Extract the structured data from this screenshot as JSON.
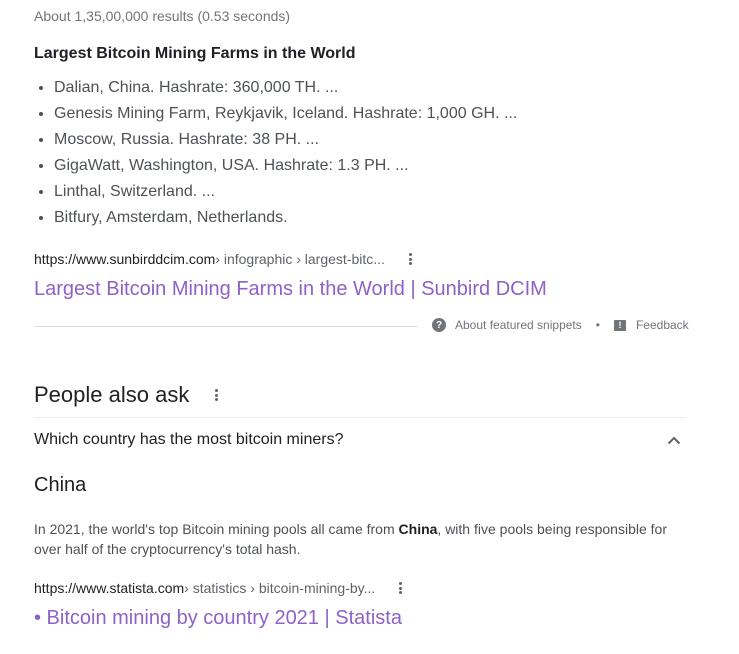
{
  "stats": "About 1,35,00,000 results (0.53 seconds)",
  "featured_snippet": {
    "title": "Largest Bitcoin Mining Farms in the World",
    "items": [
      "Dalian, China. Hashrate: 360,000 TH. ...",
      "Genesis Mining Farm, Reykjavik, Iceland. Hashrate: 1,000 GH. ...",
      "Moscow, Russia. Hashrate: 38 PH. ...",
      "GigaWatt, Washington, USA. Hashrate: 1.3 PH. ...",
      "Linthal, Switzerland. ...",
      "Bitfury, Amsterdam, Netherlands."
    ],
    "cite_domain": "https://www.sunbirddcim.com",
    "cite_path": " › infographic › largest-bitc...",
    "link_title": "Largest Bitcoin Mining Farms in the World | Sunbird DCIM",
    "about_label": "About featured snippets",
    "separator": "•",
    "feedback_label": "Feedback",
    "link_color": "#8f61c7"
  },
  "people_also_ask": {
    "title": "People also ask",
    "question": "Which country has the most bitcoin miners?",
    "answer": "China",
    "answer_text_before": "In 2021, the world's top Bitcoin mining pools all came from ",
    "answer_text_bold": "China",
    "answer_text_after": ", with five pools being responsible for over half of the cryptocurrency's total hash.",
    "cite_domain": "https://www.statista.com",
    "cite_path": " › statistics › bitcoin-mining-by...",
    "link_title": "• Bitcoin mining by country 2021 | Statista"
  },
  "icons": {
    "more": "kebab-icon",
    "help": "question-circle-icon",
    "feedback": "feedback-icon",
    "chevron": "chevron-up-icon"
  }
}
